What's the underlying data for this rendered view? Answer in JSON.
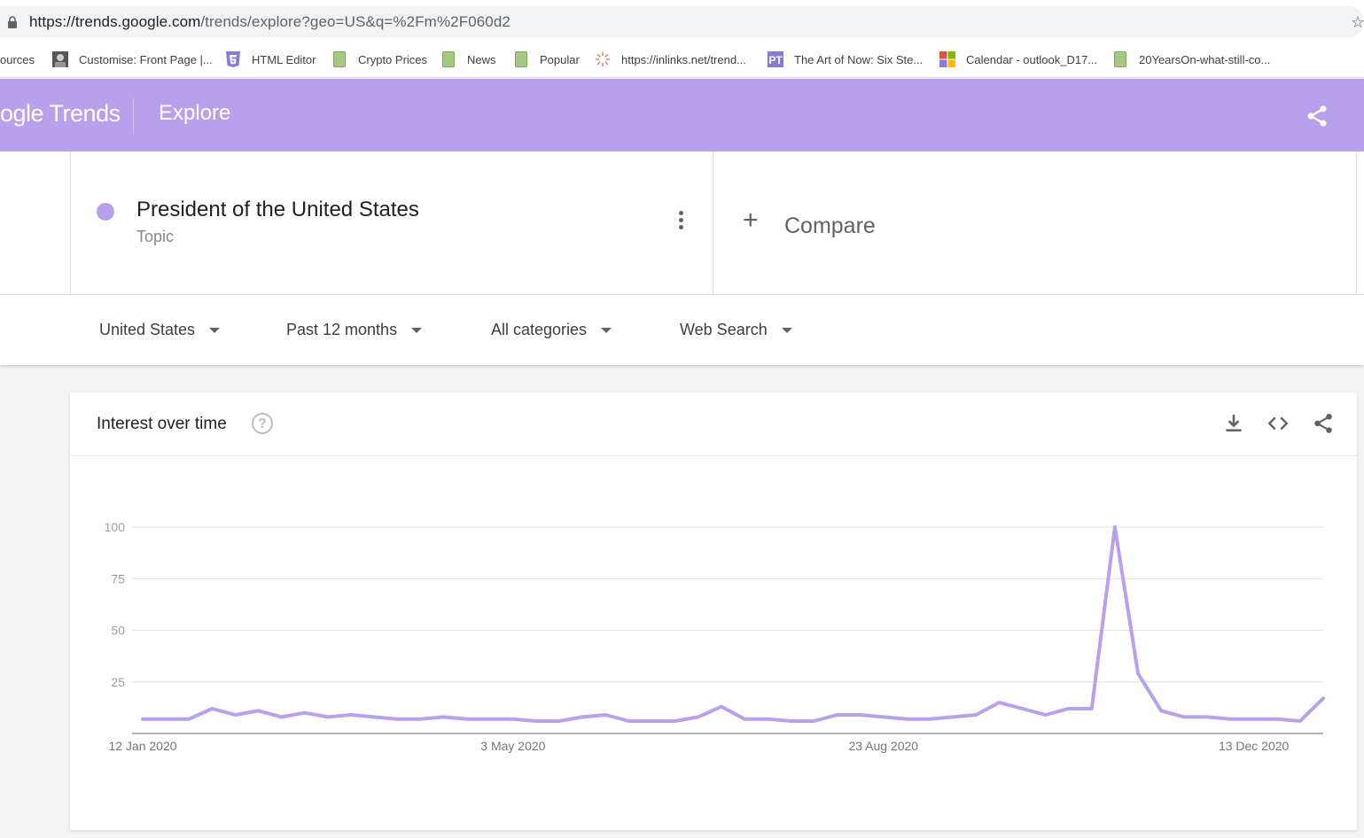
{
  "browser": {
    "url_host": "https://trends.google.com",
    "url_path": "/trends/explore?geo=US&q=%2Fm%2F060d2",
    "bookmarks": [
      {
        "label": "ources",
        "icon": "none"
      },
      {
        "label": "Customise: Front Page |...",
        "icon": "avatar-icon"
      },
      {
        "label": "HTML Editor",
        "icon": "html5-icon"
      },
      {
        "label": "Crypto Prices",
        "icon": "page-icon"
      },
      {
        "label": "News",
        "icon": "page-icon"
      },
      {
        "label": "Popular",
        "icon": "page-icon"
      },
      {
        "label": "https://inlinks.net/trend...",
        "icon": "sunburst-icon"
      },
      {
        "label": "The Art of Now: Six Ste...",
        "icon": "pt-icon"
      },
      {
        "label": "Calendar - outlook_D17...",
        "icon": "microsoft-icon"
      },
      {
        "label": "20YearsOn-what-still-co...",
        "icon": "page-icon"
      }
    ]
  },
  "header": {
    "logo": "ogle Trends",
    "section": "Explore",
    "accent_color": "#b9a0ec"
  },
  "search_term": {
    "name": "President of the United States",
    "type": "Topic",
    "compare_label": "Compare"
  },
  "filters": {
    "region": "United States",
    "time": "Past 12 months",
    "category": "All categories",
    "property": "Web Search"
  },
  "card": {
    "title": "Interest over time",
    "help": "?"
  },
  "chart_data": {
    "type": "line",
    "title": "Interest over time",
    "xlabel": "",
    "ylabel": "",
    "ylim": [
      0,
      100
    ],
    "yticks": [
      25,
      50,
      75,
      100
    ],
    "grid": true,
    "x_tick_labels": [
      "12 Jan 2020",
      "3 May 2020",
      "23 Aug 2020",
      "13 Dec 2020"
    ],
    "x_tick_week_index": [
      0,
      16,
      32,
      48
    ],
    "series": [
      {
        "color": "#b9a0ec",
        "values": [
          7,
          7,
          7,
          12,
          9,
          11,
          8,
          10,
          8,
          9,
          8,
          7,
          7,
          8,
          7,
          7,
          7,
          6,
          6,
          8,
          9,
          6,
          6,
          6,
          8,
          13,
          7,
          7,
          6,
          6,
          9,
          9,
          8,
          7,
          7,
          8,
          9,
          15,
          12,
          9,
          12,
          12,
          100,
          29,
          11,
          8,
          8,
          7,
          7,
          7,
          6,
          17
        ]
      }
    ]
  }
}
